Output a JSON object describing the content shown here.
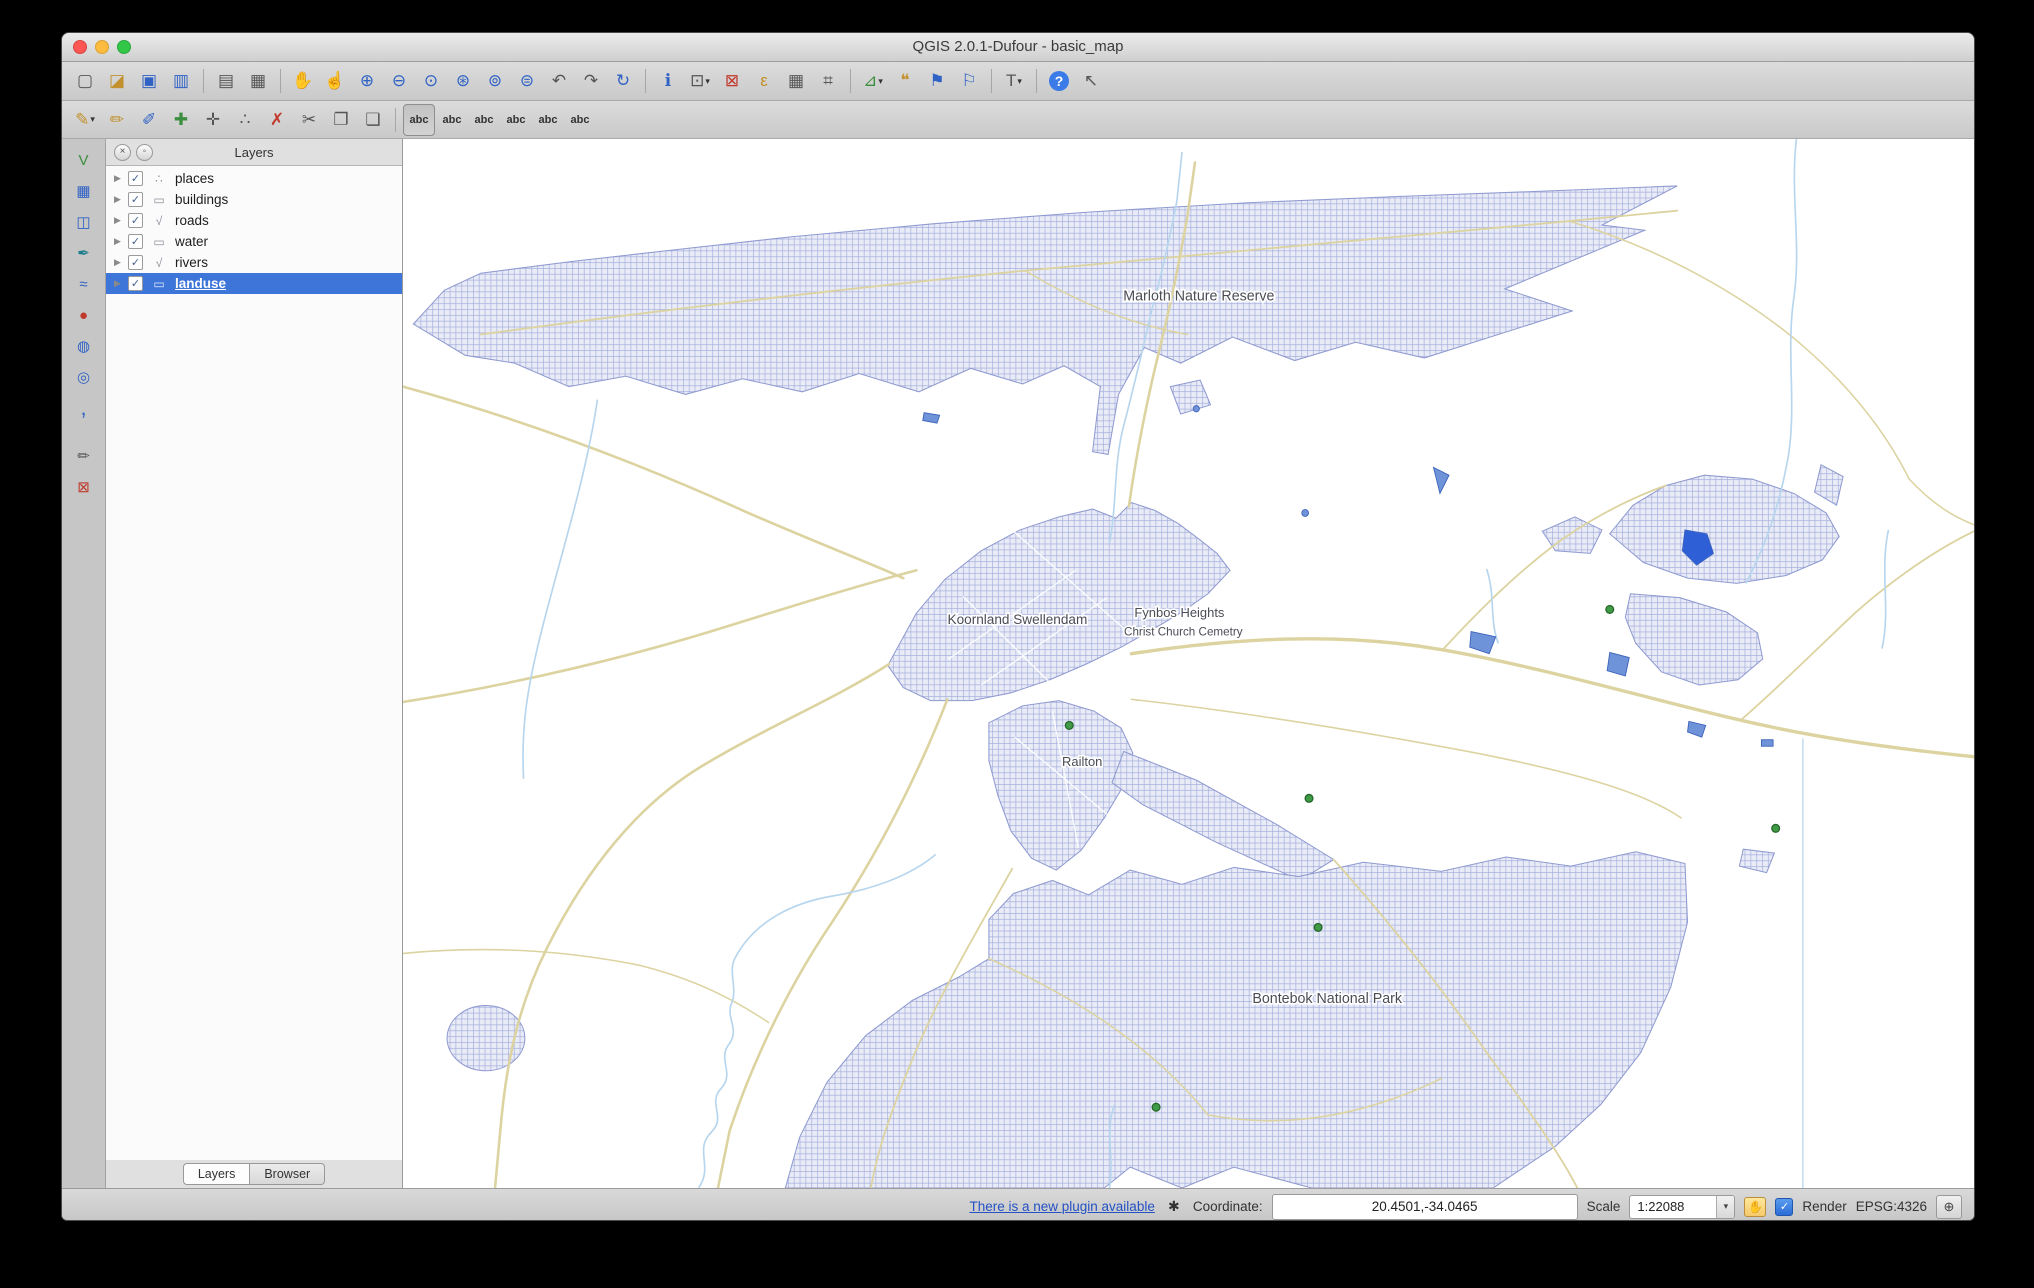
{
  "window": {
    "title": "QGIS 2.0.1-Dufour - basic_map"
  },
  "icons": {
    "checkmark": "✓",
    "dropdown": "▾",
    "expander": "▶",
    "new_project": "▢",
    "open_project": "◪",
    "save_project": "▣",
    "save_project_as": "▥",
    "new_composer": "▤",
    "composer_manager": "▦",
    "pan_map": "✋",
    "pan_to_selection": "☝",
    "zoom_in": "⊕",
    "zoom_out": "⊖",
    "zoom_native": "⊙",
    "zoom_full": "⊛",
    "zoom_selection": "⊚",
    "zoom_layer": "⊜",
    "zoom_last": "↶",
    "zoom_next": "↷",
    "refresh": "↻",
    "identify": "ℹ",
    "select_features": "⊡",
    "deselect": "⊠",
    "select_expression": "ε",
    "attribute_table": "▦",
    "field_calculator": "⌗",
    "measure": "⊿",
    "map_tips": "❝",
    "new_bookmark": "⚑",
    "show_bookmarks": "⚐",
    "annotation": "T",
    "help": "?",
    "whats_this": "↖",
    "current_edits": "✎",
    "toggle_editing": "✏",
    "save_edits": "✐",
    "add_feature": "✚",
    "move_feature": "✛",
    "node_tool": "∴",
    "delete_selected": "✗",
    "cut_features": "✂",
    "copy_features": "❐",
    "paste_features": "❏",
    "label_options": "abc",
    "label_pin": "abc",
    "label_highlight": "abc",
    "label_move": "abc",
    "label_rotate": "abc",
    "label_properties": "abc",
    "add_vector": "V",
    "add_raster": "▦",
    "add_postgis": "◫",
    "add_spatialite": "✒",
    "add_mssql": "≈",
    "add_oracle": "●",
    "add_wms": "◍",
    "add_wfs": "◎",
    "add_delimited": ",",
    "new_shapefile": "✏",
    "remove_layer": "⊠",
    "plugin_badge": "✱",
    "log_messages": "✋",
    "crs_picker": "⊕"
  },
  "panel": {
    "title": "Layers",
    "tabs": [
      "Layers",
      "Browser"
    ]
  },
  "layers": {
    "items": [
      {
        "label": "places",
        "geom_glyph": "∴"
      },
      {
        "label": "buildings",
        "geom_glyph": "▭"
      },
      {
        "label": "roads",
        "geom_glyph": "√"
      },
      {
        "label": "water",
        "geom_glyph": "▭"
      },
      {
        "label": "rivers",
        "geom_glyph": "√"
      },
      {
        "label": "landuse",
        "geom_glyph": "▭"
      }
    ]
  },
  "map": {
    "labels": {
      "reserve": "Marloth Nature Reserve",
      "town": "Koornland Swellendam",
      "fynbos": "Fynbos Heights",
      "cemetery": "Christ Church Cemetry",
      "railton": "Railton",
      "park": "Bontebok National Park"
    },
    "colors": {
      "landuse_fill": "#e9ecf7",
      "landuse_hatch": "#a7b0dd",
      "landuse_stroke": "#8f9ad0",
      "road": "#dcd3a0",
      "river": "#b7d6ee",
      "water_fill": "#6f93d8",
      "point": "#3f9b45"
    }
  },
  "status": {
    "plugin_link": "There is a new plugin available",
    "coordinate_label": "Coordinate:",
    "coordinate_value": "20.4501,-34.0465",
    "scale_label": "Scale",
    "scale_value": "1:22088",
    "render_label": "Render",
    "crs_label": "EPSG:4326"
  }
}
